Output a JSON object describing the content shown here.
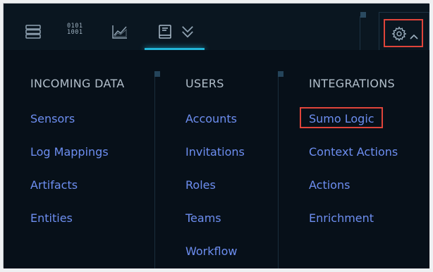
{
  "topbar": {
    "icons": [
      "database-icon",
      "binary-icon",
      "chart-icon",
      "book-icon",
      "chevron-down-icon",
      "gear-icon",
      "chevron-up-icon"
    ],
    "binary_text": [
      "0101",
      "1001"
    ]
  },
  "menu": {
    "columns": [
      {
        "heading": "INCOMING DATA",
        "items": [
          "Sensors",
          "Log Mappings",
          "Artifacts",
          "Entities"
        ]
      },
      {
        "heading": "USERS",
        "items": [
          "Accounts",
          "Invitations",
          "Roles",
          "Teams",
          "Workflow"
        ]
      },
      {
        "heading": "INTEGRATIONS",
        "items": [
          "Sumo Logic",
          "Context Actions",
          "Actions",
          "Enrichment"
        ]
      }
    ],
    "highlighted_item": "Sumo Logic"
  },
  "colors": {
    "background": "#071019",
    "link": "#6d8ef0",
    "heading": "#b2bfcb",
    "accent": "#22b6d8",
    "highlight": "#e0443a"
  }
}
